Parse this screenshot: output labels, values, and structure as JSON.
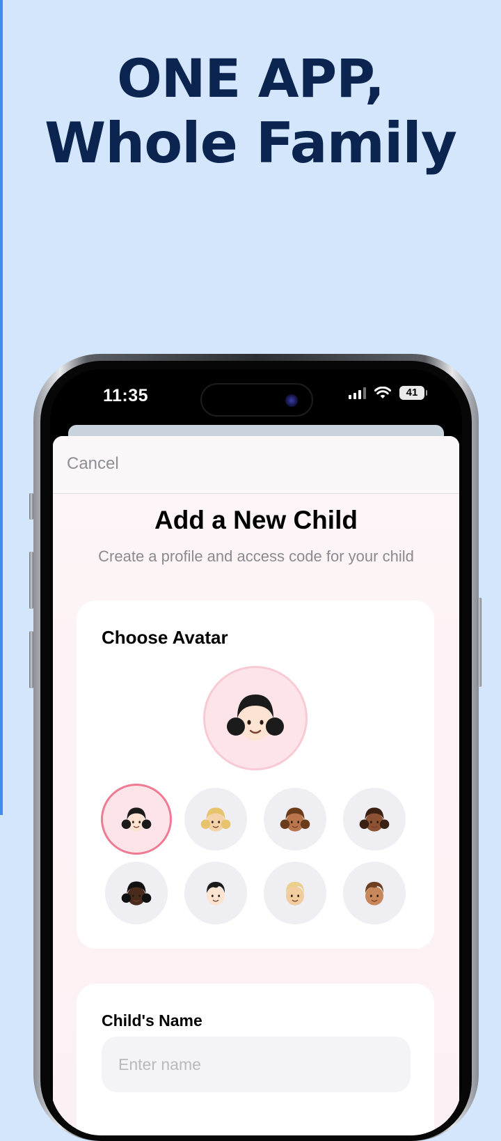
{
  "headline": {
    "line1": "ONE APP,",
    "line2": "Whole Family"
  },
  "status_bar": {
    "time": "11:35",
    "battery": "41"
  },
  "sheet": {
    "cancel_label": "Cancel",
    "title": "Add a New Child",
    "subtitle": "Create a profile and access code for your child"
  },
  "avatar_section": {
    "label": "Choose Avatar",
    "selected_index": 0,
    "options": [
      {
        "name": "girl-black-pigtails-light",
        "skin": "#fde3d2",
        "hair": "#1b1b1b",
        "style": "pigtails"
      },
      {
        "name": "girl-blonde-medium-light",
        "skin": "#f3d2a8",
        "hair": "#e7c36b",
        "style": "pigtails"
      },
      {
        "name": "girl-brown-medium",
        "skin": "#b9764d",
        "hair": "#6a3c1c",
        "style": "pigtails"
      },
      {
        "name": "girl-dark-medium-dark",
        "skin": "#8d5233",
        "hair": "#3a2114",
        "style": "pigtails"
      },
      {
        "name": "girl-black-dark",
        "skin": "#4a2c1e",
        "hair": "#111111",
        "style": "pigtails"
      },
      {
        "name": "boy-black-light",
        "skin": "#fde3d2",
        "hair": "#1b1b1b",
        "style": "short"
      },
      {
        "name": "boy-blonde-medium-light",
        "skin": "#f1cc9e",
        "hair": "#ead08c",
        "style": "short"
      },
      {
        "name": "boy-brown-medium",
        "skin": "#c8865b",
        "hair": "#6e3f21",
        "style": "short"
      }
    ]
  },
  "name_section": {
    "label": "Child's Name",
    "placeholder": "Enter name",
    "value": ""
  }
}
